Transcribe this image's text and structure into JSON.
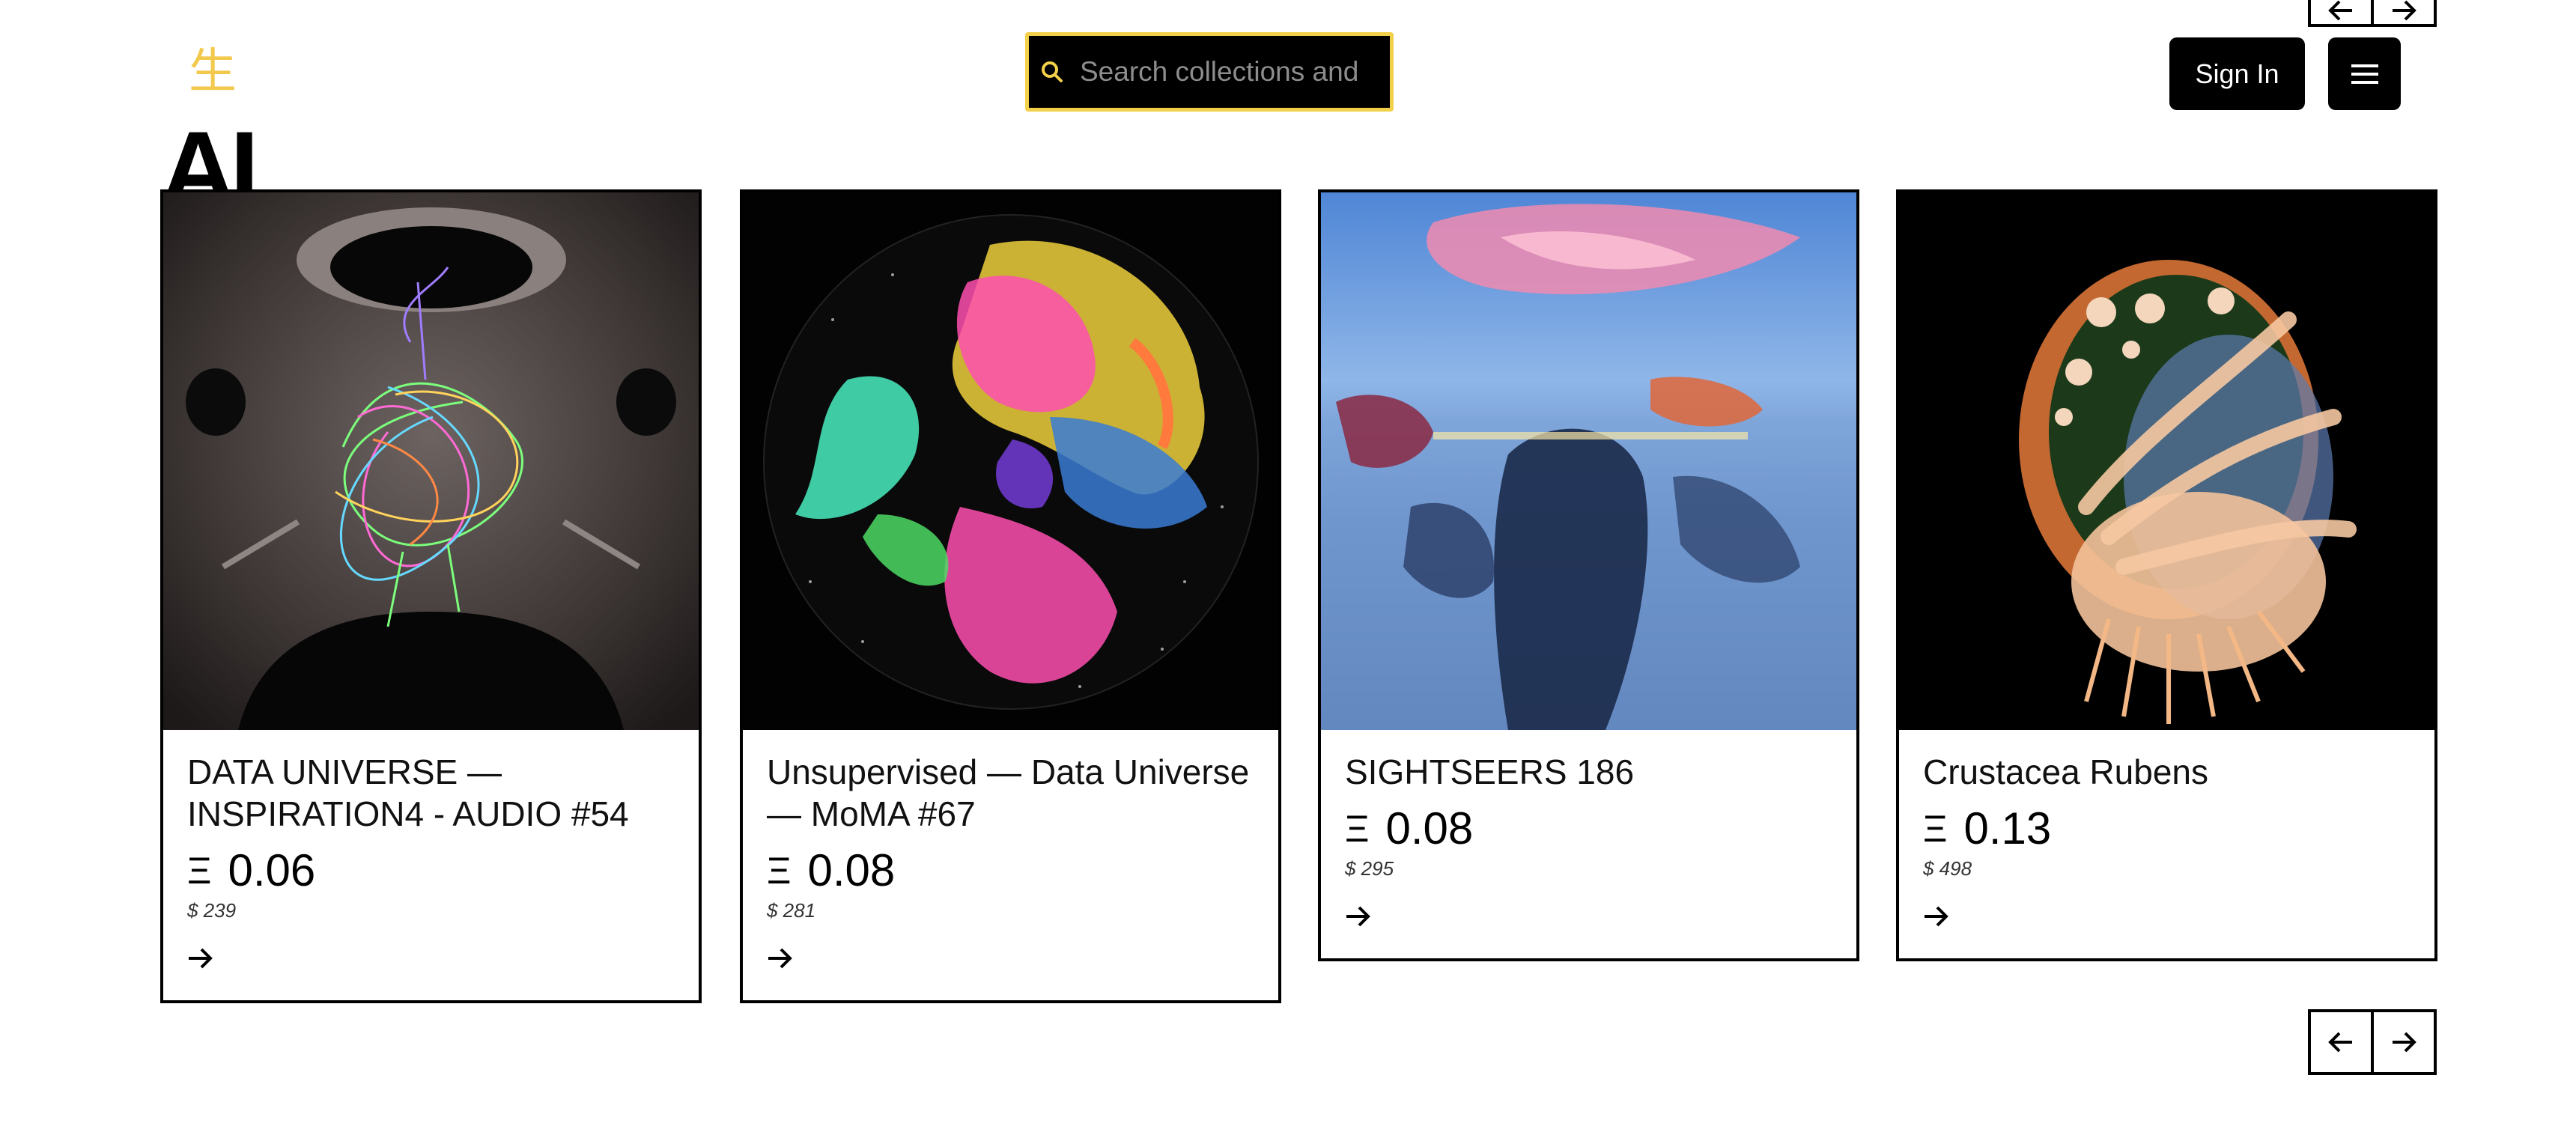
{
  "header": {
    "logo_glyph": "生",
    "search_placeholder": "Search collections and adc",
    "sign_in_label": "Sign In",
    "menu_icon": "hamburger-menu-icon",
    "accent_color": "#f2d04a"
  },
  "section": {
    "title": "AI"
  },
  "cards": [
    {
      "title": "DATA UNIVERSE — INSPIRATION4 - AUDIO #54",
      "eth_symbol": "Ξ",
      "price_eth": "0.06",
      "price_usd": "$ 239"
    },
    {
      "title": "Unsupervised — Data Universe — MoMA #67",
      "eth_symbol": "Ξ",
      "price_eth": "0.08",
      "price_usd": "$ 281"
    },
    {
      "title": "SIGHTSEERS 186",
      "eth_symbol": "Ξ",
      "price_eth": "0.08",
      "price_usd": "$ 295"
    },
    {
      "title": "Crustacea Rubens",
      "eth_symbol": "Ξ",
      "price_eth": "0.13",
      "price_usd": "$ 498"
    }
  ],
  "carousel": {
    "prev_icon": "arrow-left-icon",
    "next_icon": "arrow-right-icon"
  }
}
